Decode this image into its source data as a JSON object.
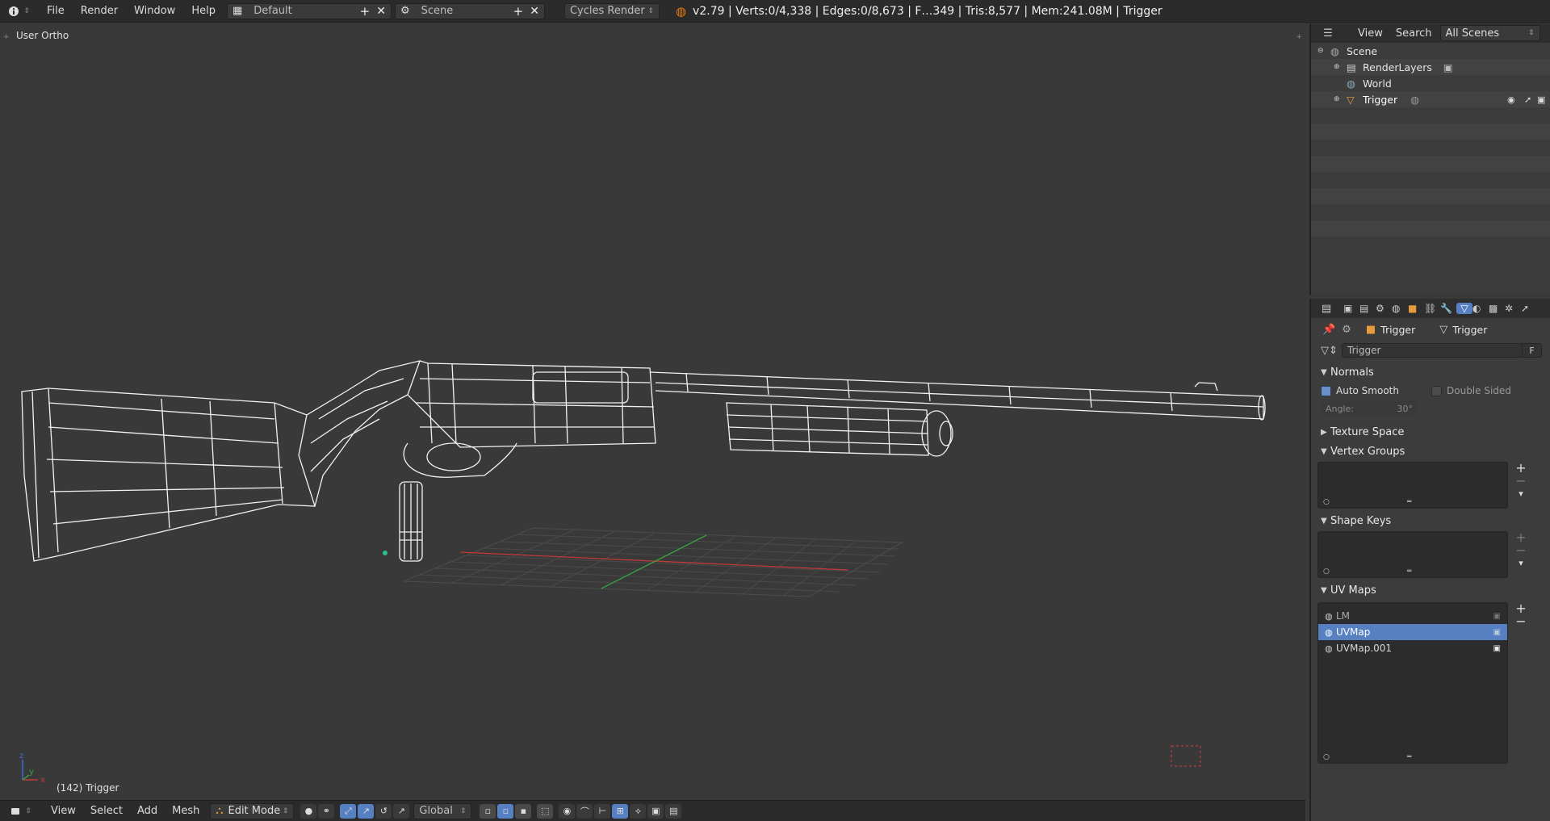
{
  "topbar": {
    "menus": [
      "File",
      "Render",
      "Window",
      "Help"
    ],
    "layout": "Default",
    "scene": "Scene",
    "engine": "Cycles Render",
    "stats": "v2.79 | Verts:0/4,338 | Edges:0/8,673 | F…349 | Tris:8,577 | Mem:241.08M | Trigger"
  },
  "viewport": {
    "view_label": "User Ortho",
    "object_label": "(142) Trigger",
    "axis": {
      "x": "x",
      "y": "y",
      "z": "z"
    }
  },
  "bottombar": {
    "menus": [
      "View",
      "Select",
      "Add",
      "Mesh"
    ],
    "mode": "Edit Mode",
    "orientation": "Global"
  },
  "outliner": {
    "view_menu": "View",
    "search_menu": "Search",
    "filter": "All Scenes",
    "items": [
      {
        "label": "Scene"
      },
      {
        "label": "RenderLayers"
      },
      {
        "label": "World"
      },
      {
        "label": "Trigger"
      }
    ]
  },
  "properties": {
    "breadcrumb_object": "Trigger",
    "breadcrumb_mesh": "Trigger",
    "mesh_name": "Trigger",
    "fake_user": "F",
    "normals": {
      "title": "Normals",
      "auto_smooth": "Auto Smooth",
      "double_sided": "Double Sided",
      "angle_label": "Angle:",
      "angle_value": "30°"
    },
    "texture_space": "Texture Space",
    "vertex_groups": "Vertex Groups",
    "shape_keys": "Shape Keys",
    "uv_maps": {
      "title": "UV Maps",
      "items": [
        "LM",
        "UVMap",
        "UVMap.001"
      ],
      "selected": "UVMap"
    }
  },
  "colors": {
    "accent": "#5680c2",
    "wire": "#ffffff",
    "x_axis": "#c03a3a",
    "y_axis": "#3aa03a"
  }
}
